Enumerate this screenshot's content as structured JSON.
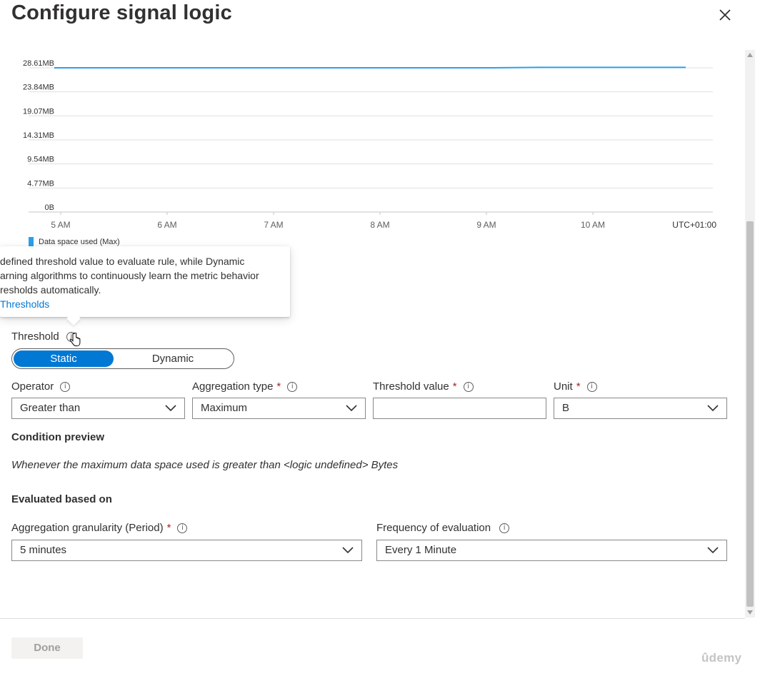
{
  "header": {
    "title": "Configure signal logic"
  },
  "chart_data": {
    "type": "line",
    "yticks": [
      "28.61MB",
      "23.84MB",
      "19.07MB",
      "14.31MB",
      "9.54MB",
      "4.77MB",
      "0B"
    ],
    "xticks": [
      "5 AM",
      "6 AM",
      "7 AM",
      "8 AM",
      "9 AM",
      "10 AM"
    ],
    "timezone": "UTC+01:00",
    "ylim": [
      "0B",
      "28.61MB"
    ],
    "grid": true,
    "legend_position": "bottom-left",
    "series": [
      {
        "name": "Data space used (Max)",
        "color": "#2aa0ea",
        "values_mb": [
          28.61,
          28.61,
          28.61,
          28.61,
          28.61,
          28.61,
          28.61,
          28.61,
          28.61,
          28.61,
          28.7,
          28.7,
          28.7,
          28.7
        ]
      }
    ]
  },
  "tooltip": {
    "lines": [
      "defined threshold value to evaluate rule, while Dynamic",
      "arning algorithms to continuously learn the metric behavior",
      "resholds automatically."
    ],
    "link": "Thresholds"
  },
  "threshold": {
    "label": "Threshold",
    "options": [
      "Static",
      "Dynamic"
    ],
    "selected": "Static"
  },
  "fields": {
    "operator": {
      "label": "Operator",
      "value": "Greater than"
    },
    "aggregation_type": {
      "label": "Aggregation type",
      "value": "Maximum"
    },
    "threshold_value": {
      "label": "Threshold value",
      "value": ""
    },
    "unit": {
      "label": "Unit",
      "value": "B"
    }
  },
  "condition_preview": {
    "heading": "Condition preview",
    "text": "Whenever the maximum data space used is greater than <logic undefined> Bytes"
  },
  "evaluated": {
    "heading": "Evaluated based on",
    "granularity": {
      "label": "Aggregation granularity (Period)",
      "value": "5 minutes"
    },
    "frequency": {
      "label": "Frequency of evaluation",
      "value": "Every 1 Minute"
    }
  },
  "footer": {
    "done_label": "Done"
  },
  "watermark": "ûdemy",
  "info_glyph": "i",
  "required_mark": "*",
  "colors": {
    "accent": "#0078d4",
    "series": "#2aa0ea",
    "required": "#a4262c"
  }
}
